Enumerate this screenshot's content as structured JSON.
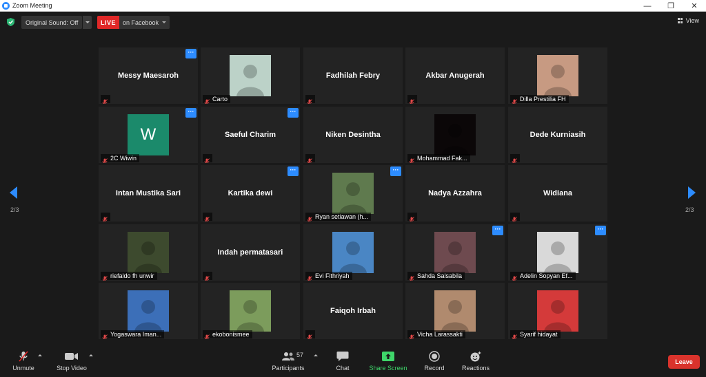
{
  "window": {
    "title": "Zoom Meeting",
    "minimize": "—",
    "restore": "❐",
    "close": "✕"
  },
  "topbar": {
    "original_sound": "Original Sound: Off",
    "live_label": "LIVE",
    "live_destination": "on Facebook",
    "view_label": "View"
  },
  "pagination": {
    "left": "2/3",
    "right": "2/3"
  },
  "tiles": [
    {
      "name": "Messy Maesaroh",
      "display": "name",
      "more": true,
      "video": "",
      "label": ""
    },
    {
      "name": "Carto",
      "display": "photo",
      "more": false,
      "video": "#bcd2c8",
      "label": "Carto"
    },
    {
      "name": "Fadhilah Febry",
      "display": "name",
      "more": false,
      "video": "",
      "label": ""
    },
    {
      "name": "Akbar Anugerah",
      "display": "name",
      "more": false,
      "video": "",
      "label": ""
    },
    {
      "name": "Dilla Prestilia FH",
      "display": "photo",
      "more": false,
      "video": "#c79a82",
      "label": "Dilla Prestilia FH"
    },
    {
      "name": "2C Wiwin",
      "display": "avatar",
      "more": true,
      "video": "",
      "label": "2C Wiwin",
      "initial": "W"
    },
    {
      "name": "Saeful Charim",
      "display": "name",
      "more": true,
      "video": "",
      "label": ""
    },
    {
      "name": "Niken Desintha",
      "display": "name",
      "more": false,
      "video": "",
      "label": ""
    },
    {
      "name": "Mohammad Fak...",
      "display": "photo",
      "more": false,
      "video": "#0b0708",
      "label": "Mohammad Fak..."
    },
    {
      "name": "Dede Kurniasih",
      "display": "name",
      "more": false,
      "video": "",
      "label": ""
    },
    {
      "name": "Intan Mustika Sari",
      "display": "name",
      "more": false,
      "video": "",
      "label": ""
    },
    {
      "name": "Kartika dewi",
      "display": "name",
      "more": true,
      "video": "",
      "label": ""
    },
    {
      "name": "Ryan setiawan (h...",
      "display": "photo",
      "more": true,
      "video": "#5f7a4e",
      "label": "Ryan setiawan (h..."
    },
    {
      "name": "Nadya Azzahra",
      "display": "name",
      "more": false,
      "video": "",
      "label": ""
    },
    {
      "name": "Widiana",
      "display": "name",
      "more": false,
      "video": "",
      "label": ""
    },
    {
      "name": "riefaldo fh unwir",
      "display": "photo",
      "more": false,
      "video": "#3d4a2e",
      "label": "riefaldo fh unwir"
    },
    {
      "name": "Indah permatasari",
      "display": "name",
      "more": false,
      "video": "",
      "label": ""
    },
    {
      "name": "Evi Fithriyah",
      "display": "photo",
      "more": false,
      "video": "#4a86c4",
      "label": "Evi Fithriyah"
    },
    {
      "name": "Sahda Salsabila",
      "display": "photo",
      "more": true,
      "video": "#6e4a4f",
      "label": "Sahda Salsabila"
    },
    {
      "name": "Adelin Sopyan Ef...",
      "display": "photo",
      "more": true,
      "video": "#d9d9d9",
      "label": "Adelin Sopyan Ef..."
    },
    {
      "name": "Yogaswara Iman...",
      "display": "photo",
      "more": false,
      "video": "#3c6fb8",
      "label": "Yogaswara Iman..."
    },
    {
      "name": "ekobonismee",
      "display": "photo",
      "more": false,
      "video": "#7c9c5c",
      "label": "ekobonismee"
    },
    {
      "name": "Faiqoh Irbah",
      "display": "name",
      "more": false,
      "video": "",
      "label": ""
    },
    {
      "name": "Vicha Larassakti",
      "display": "photo",
      "more": false,
      "video": "#b08a6e",
      "label": "Vicha Larassakti"
    },
    {
      "name": "Syarif hidayat",
      "display": "photo",
      "more": false,
      "video": "#d43a3a",
      "label": "Syarif hidayat"
    }
  ],
  "toolbar": {
    "unmute": "Unmute",
    "stop_video": "Stop Video",
    "participants": "Participants",
    "participants_count": "57",
    "chat": "Chat",
    "share_screen": "Share Screen",
    "record": "Record",
    "reactions": "Reactions",
    "leave": "Leave"
  },
  "colors": {
    "accent": "#2d8cff",
    "live": "#e02828",
    "share": "#3fd66a",
    "leave": "#d9332c",
    "tile": "#232323",
    "background": "#1a1a1a"
  }
}
